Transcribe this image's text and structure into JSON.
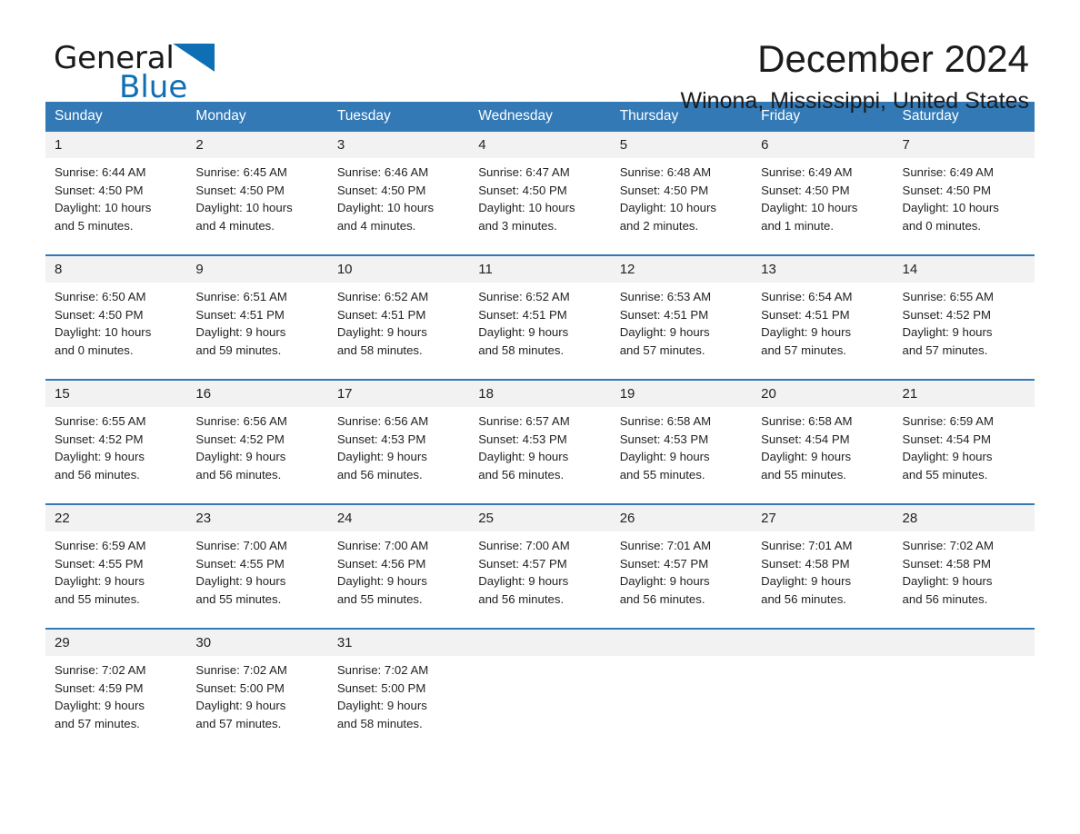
{
  "brand": {
    "name_part1": "General",
    "name_part2": "Blue",
    "accent_color": "#0f6fb5"
  },
  "header": {
    "title": "December 2024",
    "subtitle": "Winona, Mississippi, United States"
  },
  "calendar": {
    "header_bg": "#3279b6",
    "daynum_bg": "#f2f2f2",
    "weekday_headers": [
      "Sunday",
      "Monday",
      "Tuesday",
      "Wednesday",
      "Thursday",
      "Friday",
      "Saturday"
    ],
    "weeks": [
      [
        {
          "day": "1",
          "sunrise": "Sunrise: 6:44 AM",
          "sunset": "Sunset: 4:50 PM",
          "daylight_line1": "Daylight: 10 hours",
          "daylight_line2": "and 5 minutes."
        },
        {
          "day": "2",
          "sunrise": "Sunrise: 6:45 AM",
          "sunset": "Sunset: 4:50 PM",
          "daylight_line1": "Daylight: 10 hours",
          "daylight_line2": "and 4 minutes."
        },
        {
          "day": "3",
          "sunrise": "Sunrise: 6:46 AM",
          "sunset": "Sunset: 4:50 PM",
          "daylight_line1": "Daylight: 10 hours",
          "daylight_line2": "and 4 minutes."
        },
        {
          "day": "4",
          "sunrise": "Sunrise: 6:47 AM",
          "sunset": "Sunset: 4:50 PM",
          "daylight_line1": "Daylight: 10 hours",
          "daylight_line2": "and 3 minutes."
        },
        {
          "day": "5",
          "sunrise": "Sunrise: 6:48 AM",
          "sunset": "Sunset: 4:50 PM",
          "daylight_line1": "Daylight: 10 hours",
          "daylight_line2": "and 2 minutes."
        },
        {
          "day": "6",
          "sunrise": "Sunrise: 6:49 AM",
          "sunset": "Sunset: 4:50 PM",
          "daylight_line1": "Daylight: 10 hours",
          "daylight_line2": "and 1 minute."
        },
        {
          "day": "7",
          "sunrise": "Sunrise: 6:49 AM",
          "sunset": "Sunset: 4:50 PM",
          "daylight_line1": "Daylight: 10 hours",
          "daylight_line2": "and 0 minutes."
        }
      ],
      [
        {
          "day": "8",
          "sunrise": "Sunrise: 6:50 AM",
          "sunset": "Sunset: 4:50 PM",
          "daylight_line1": "Daylight: 10 hours",
          "daylight_line2": "and 0 minutes."
        },
        {
          "day": "9",
          "sunrise": "Sunrise: 6:51 AM",
          "sunset": "Sunset: 4:51 PM",
          "daylight_line1": "Daylight: 9 hours",
          "daylight_line2": "and 59 minutes."
        },
        {
          "day": "10",
          "sunrise": "Sunrise: 6:52 AM",
          "sunset": "Sunset: 4:51 PM",
          "daylight_line1": "Daylight: 9 hours",
          "daylight_line2": "and 58 minutes."
        },
        {
          "day": "11",
          "sunrise": "Sunrise: 6:52 AM",
          "sunset": "Sunset: 4:51 PM",
          "daylight_line1": "Daylight: 9 hours",
          "daylight_line2": "and 58 minutes."
        },
        {
          "day": "12",
          "sunrise": "Sunrise: 6:53 AM",
          "sunset": "Sunset: 4:51 PM",
          "daylight_line1": "Daylight: 9 hours",
          "daylight_line2": "and 57 minutes."
        },
        {
          "day": "13",
          "sunrise": "Sunrise: 6:54 AM",
          "sunset": "Sunset: 4:51 PM",
          "daylight_line1": "Daylight: 9 hours",
          "daylight_line2": "and 57 minutes."
        },
        {
          "day": "14",
          "sunrise": "Sunrise: 6:55 AM",
          "sunset": "Sunset: 4:52 PM",
          "daylight_line1": "Daylight: 9 hours",
          "daylight_line2": "and 57 minutes."
        }
      ],
      [
        {
          "day": "15",
          "sunrise": "Sunrise: 6:55 AM",
          "sunset": "Sunset: 4:52 PM",
          "daylight_line1": "Daylight: 9 hours",
          "daylight_line2": "and 56 minutes."
        },
        {
          "day": "16",
          "sunrise": "Sunrise: 6:56 AM",
          "sunset": "Sunset: 4:52 PM",
          "daylight_line1": "Daylight: 9 hours",
          "daylight_line2": "and 56 minutes."
        },
        {
          "day": "17",
          "sunrise": "Sunrise: 6:56 AM",
          "sunset": "Sunset: 4:53 PM",
          "daylight_line1": "Daylight: 9 hours",
          "daylight_line2": "and 56 minutes."
        },
        {
          "day": "18",
          "sunrise": "Sunrise: 6:57 AM",
          "sunset": "Sunset: 4:53 PM",
          "daylight_line1": "Daylight: 9 hours",
          "daylight_line2": "and 56 minutes."
        },
        {
          "day": "19",
          "sunrise": "Sunrise: 6:58 AM",
          "sunset": "Sunset: 4:53 PM",
          "daylight_line1": "Daylight: 9 hours",
          "daylight_line2": "and 55 minutes."
        },
        {
          "day": "20",
          "sunrise": "Sunrise: 6:58 AM",
          "sunset": "Sunset: 4:54 PM",
          "daylight_line1": "Daylight: 9 hours",
          "daylight_line2": "and 55 minutes."
        },
        {
          "day": "21",
          "sunrise": "Sunrise: 6:59 AM",
          "sunset": "Sunset: 4:54 PM",
          "daylight_line1": "Daylight: 9 hours",
          "daylight_line2": "and 55 minutes."
        }
      ],
      [
        {
          "day": "22",
          "sunrise": "Sunrise: 6:59 AM",
          "sunset": "Sunset: 4:55 PM",
          "daylight_line1": "Daylight: 9 hours",
          "daylight_line2": "and 55 minutes."
        },
        {
          "day": "23",
          "sunrise": "Sunrise: 7:00 AM",
          "sunset": "Sunset: 4:55 PM",
          "daylight_line1": "Daylight: 9 hours",
          "daylight_line2": "and 55 minutes."
        },
        {
          "day": "24",
          "sunrise": "Sunrise: 7:00 AM",
          "sunset": "Sunset: 4:56 PM",
          "daylight_line1": "Daylight: 9 hours",
          "daylight_line2": "and 55 minutes."
        },
        {
          "day": "25",
          "sunrise": "Sunrise: 7:00 AM",
          "sunset": "Sunset: 4:57 PM",
          "daylight_line1": "Daylight: 9 hours",
          "daylight_line2": "and 56 minutes."
        },
        {
          "day": "26",
          "sunrise": "Sunrise: 7:01 AM",
          "sunset": "Sunset: 4:57 PM",
          "daylight_line1": "Daylight: 9 hours",
          "daylight_line2": "and 56 minutes."
        },
        {
          "day": "27",
          "sunrise": "Sunrise: 7:01 AM",
          "sunset": "Sunset: 4:58 PM",
          "daylight_line1": "Daylight: 9 hours",
          "daylight_line2": "and 56 minutes."
        },
        {
          "day": "28",
          "sunrise": "Sunrise: 7:02 AM",
          "sunset": "Sunset: 4:58 PM",
          "daylight_line1": "Daylight: 9 hours",
          "daylight_line2": "and 56 minutes."
        }
      ],
      [
        {
          "day": "29",
          "sunrise": "Sunrise: 7:02 AM",
          "sunset": "Sunset: 4:59 PM",
          "daylight_line1": "Daylight: 9 hours",
          "daylight_line2": "and 57 minutes."
        },
        {
          "day": "30",
          "sunrise": "Sunrise: 7:02 AM",
          "sunset": "Sunset: 5:00 PM",
          "daylight_line1": "Daylight: 9 hours",
          "daylight_line2": "and 57 minutes."
        },
        {
          "day": "31",
          "sunrise": "Sunrise: 7:02 AM",
          "sunset": "Sunset: 5:00 PM",
          "daylight_line1": "Daylight: 9 hours",
          "daylight_line2": "and 58 minutes."
        },
        {
          "day": "",
          "sunrise": "",
          "sunset": "",
          "daylight_line1": "",
          "daylight_line2": ""
        },
        {
          "day": "",
          "sunrise": "",
          "sunset": "",
          "daylight_line1": "",
          "daylight_line2": ""
        },
        {
          "day": "",
          "sunrise": "",
          "sunset": "",
          "daylight_line1": "",
          "daylight_line2": ""
        },
        {
          "day": "",
          "sunrise": "",
          "sunset": "",
          "daylight_line1": "",
          "daylight_line2": ""
        }
      ]
    ]
  }
}
